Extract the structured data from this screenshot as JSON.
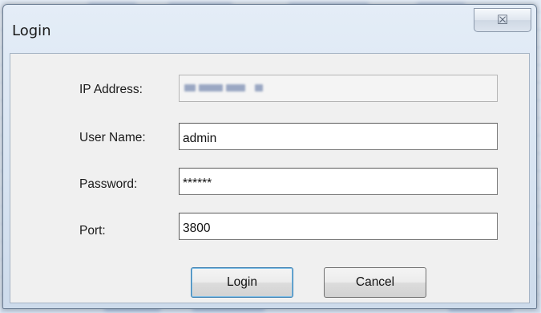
{
  "window": {
    "title": "Login",
    "close_glyph": "☒"
  },
  "form": {
    "ip_address": {
      "label": "IP Address:",
      "value": ""
    },
    "user_name": {
      "label": "User Name:",
      "value": "admin"
    },
    "password": {
      "label": "Password:",
      "value": "******"
    },
    "port": {
      "label": "Port:",
      "value": "3800"
    }
  },
  "buttons": {
    "login_label": "Login",
    "cancel_label": "Cancel"
  },
  "icons": {
    "close": "close-icon"
  }
}
